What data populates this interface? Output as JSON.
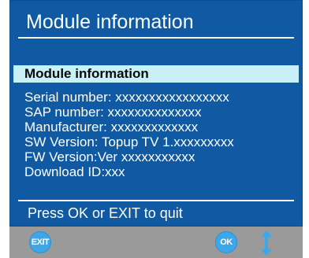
{
  "window": {
    "title": "Module information"
  },
  "section": {
    "label": "Module information"
  },
  "info_lines": [
    "Serial number: xxxxxxxxxxxxxxxxx",
    "SAP number: xxxxxxxxxxxxxx",
    "Manufacturer: xxxxxxxxxxxxx",
    "SW Version: Topup TV 1.xxxxxxxxx",
    "FW Version:Ver xxxxxxxxxxx",
    "Download ID:xxx"
  ],
  "hint": "Press OK or EXIT to quit",
  "footer": {
    "exit_label": "EXIT",
    "ok_label": "OK",
    "updown_icon": "up-down-arrow-icon"
  },
  "colors": {
    "panel_background": "#0f5aa2",
    "section_bar": "#c9f0f6",
    "footer_background": "#9a9a9a",
    "button": "#3ea7ea"
  }
}
